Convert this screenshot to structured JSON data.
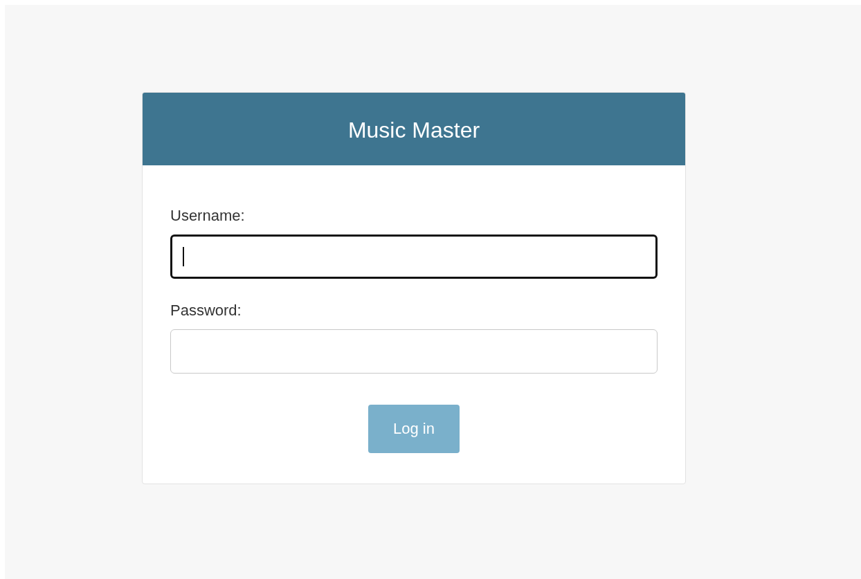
{
  "card": {
    "title": "Music Master"
  },
  "fields": [
    {
      "label": "Username:",
      "focused": true
    },
    {
      "label": "Password:",
      "focused": false
    }
  ],
  "button": {
    "label": "Log in"
  }
}
